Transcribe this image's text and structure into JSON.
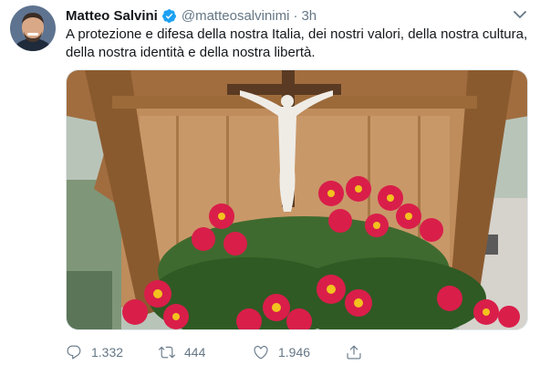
{
  "tweet": {
    "author_name": "Matteo Salvini",
    "handle": "@matteosalvinimi",
    "separator": "·",
    "time": "3h",
    "text_lines": [
      "A protezione e difesa della nostra Italia, dei nostri valori, della nostra cultura,",
      "della nostra identità e della nostra libertà."
    ],
    "verified_icon": "verified-badge",
    "menu_icon": "chevron-down",
    "colors": {
      "verified": "#1da1f2",
      "secondary_text": "#657786",
      "primary_text": "#14171a"
    }
  },
  "actions": {
    "reply_count": "1.332",
    "retweet_count": "444",
    "like_count": "1.946",
    "icons": [
      "reply-icon",
      "retweet-icon",
      "like-icon",
      "share-icon"
    ]
  }
}
